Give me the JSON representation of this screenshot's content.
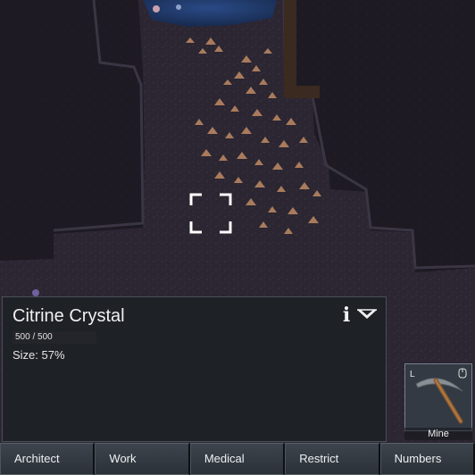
{
  "inspector": {
    "title": "Citrine Crystal",
    "hp_text": "500 / 500",
    "hp_fraction": 1.0,
    "size_text": "Size: 57%",
    "info_icon": "i",
    "info_icon_name": "info-icon",
    "collapse_icon_name": "collapse-arrow-icon"
  },
  "gizmo": {
    "label": "Mine",
    "hotkey": "L",
    "icon": "pickaxe-icon",
    "mouse_icon": "mouse-icon"
  },
  "tabs": [
    "Architect",
    "Work",
    "Medical",
    "Restrict",
    "Numbers"
  ],
  "colors": {
    "rock": "#1a1820",
    "floor": "#2a2430",
    "water": "#1f3a6a",
    "crystal": "#b08060",
    "panel": "#1e2126",
    "tab": "#343a42"
  }
}
